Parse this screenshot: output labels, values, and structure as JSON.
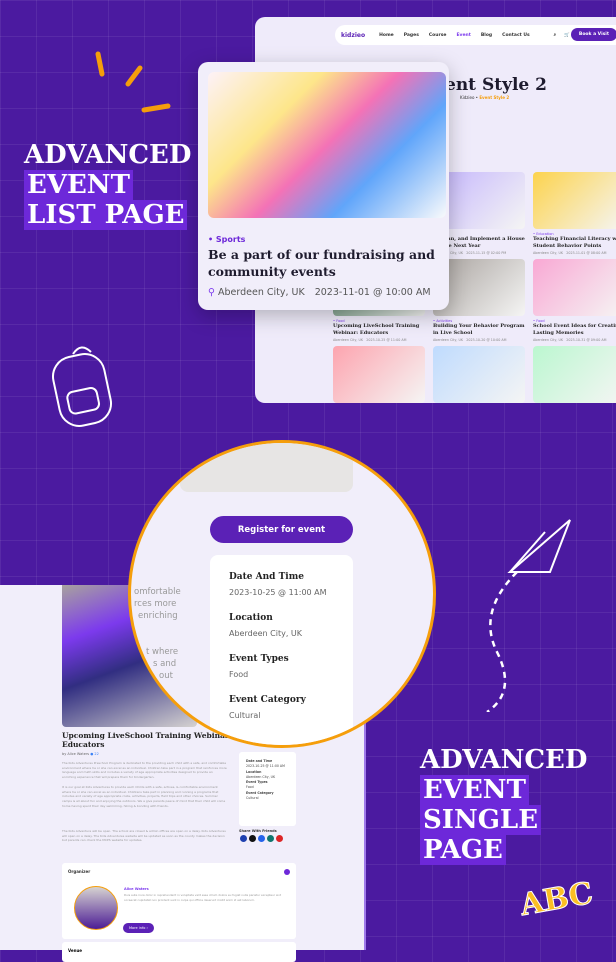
{
  "list_heading": [
    "ADVANCED",
    "EVENT",
    "LIST PAGE"
  ],
  "single_heading": [
    "ADVANCED",
    "EVENT",
    "SINGLE",
    "PAGE"
  ],
  "nav": {
    "logo": "kidzieo",
    "items": [
      "Home",
      "Pages",
      "Course",
      "Event",
      "Blog",
      "Contact Us"
    ],
    "active": "Event",
    "cart_count": "0",
    "cta": "Book a Visit"
  },
  "list_page": {
    "title": "Event Style 2",
    "title_visible": "ent Style 2",
    "breadcrumb": [
      "Kidzieo",
      "Event Style 2"
    ],
    "cards": [
      {
        "tag": "",
        "title": "..., Plan, and Implement a House Before Next Year",
        "location": "Aberdeen City, UK",
        "date": "2023-11-15 @ 02:00 PM",
        "color": "#c4b5fd"
      },
      {
        "tag": "Education",
        "title": "Teaching Financial Literacy with Student Behavior Points",
        "location": "Aberdeen City, UK",
        "date": "2023-11-01 @ 08:00 AM",
        "color": "#fcd34d"
      },
      {
        "tag": "Food",
        "title": "Upcoming LiveSchool Training Webinar: Educators",
        "location": "Aberdeen City, UK",
        "date": "2023-10-25 @ 11:00 AM",
        "color": "#4d7c5f"
      },
      {
        "tag": "Activities",
        "title": "Building Your Behavior Program in Live School",
        "location": "Aberdeen City, UK",
        "date": "2023-10-20 @ 10:00 AM",
        "color": "#a8a29e"
      },
      {
        "tag": "Food",
        "title": "School Event Ideas for Creating Lasting Memories",
        "location": "Aberdeen City, UK",
        "date": "2023-10-31 @ 09:00 AM",
        "color": "#f9a8d4"
      },
      {
        "tag": "",
        "title": "",
        "location": "",
        "date": "",
        "color": "#fda4af"
      },
      {
        "tag": "",
        "title": "",
        "location": "",
        "date": "",
        "color": "#bfdbfe"
      },
      {
        "tag": "",
        "title": "",
        "location": "",
        "date": "",
        "color": "#bbf7d0"
      }
    ]
  },
  "featured_card": {
    "tag": "Sports",
    "title": "Be a part of our fundraising and community events",
    "location": "Aberdeen City, UK",
    "date": "2023-11-01 @ 10:00 AM"
  },
  "single_page": {
    "title": "Upcoming LiveSchool Training Webinar: Educators",
    "byline": "by Alice Waters",
    "comments": "22",
    "paragraphs": [
      "The Kids Adventures Preschool Program is dedicated to the providing each child with a safe, and comfortable environment where he or she can excel as an individual. Children take part in a program that reinforces more language and math skills and includes a variety of age appropriate activities designed to provide an enriching experience that will prepare them for Kindergarten.",
      "It is our goal at Kids Adventures to provide each Childs with a safe, actives, & comfortable environment where he or she can excel as an individual. Childrens take part in planning and running a programs that includes and variety of age appropriate clubs, activities, projects, field trips and other choices. Summer camps is all about fun and enjoying the outdoors. We a give parents peace of mind that their child will come home having spent their day swimming, hiking & bonding with friends.",
      "The Kids Adventure will be open. The school are closed & admin offices are open on a delay. Kids Adventures will open on a delay. The Kids Adventures website will be updated as soon as the county makes the decision but parents can check the MCPS website for updates."
    ],
    "ghost_text": [
      "omfortable",
      "rces more",
      "enriching",
      "t where",
      "s and",
      "out"
    ],
    "share_label": "Share With Friends",
    "organizer": {
      "label": "Organizer",
      "name": "Alice Waters",
      "bio": "Duis aute irure dolor in reprehenderit in voluptate velit esse cillum dolore eu fugiat nulla pariatur excepteur sint occaecat cupidatat non proident sunt in culpa qui officia deserunt mollit anim id est laborum.",
      "more": "More info"
    },
    "venue_label": "Venue",
    "register": "Register for event",
    "details": [
      {
        "label": "Date And Time",
        "value": "2023-10-25 @ 11:00 AM"
      },
      {
        "label": "Location",
        "value": "Aberdeen City, UK"
      },
      {
        "label": "Event Types",
        "value": "Food"
      },
      {
        "label": "Event Category",
        "value": "Cultural"
      }
    ],
    "side_details": [
      {
        "label": "Date and Time",
        "value": "2023-10-25 @ 11:00 AM"
      },
      {
        "label": "Location",
        "value": "Aberdeen City, UK"
      },
      {
        "label": "Event Types",
        "value": "Food"
      },
      {
        "label": "Event Category",
        "value": "Cultural"
      }
    ]
  },
  "colors": {
    "background": "#4b1aa0",
    "accent": "#5b21b6",
    "highlight": "#6d28d9",
    "orange": "#f59e0b"
  },
  "decor": {
    "abc": "ABC"
  }
}
